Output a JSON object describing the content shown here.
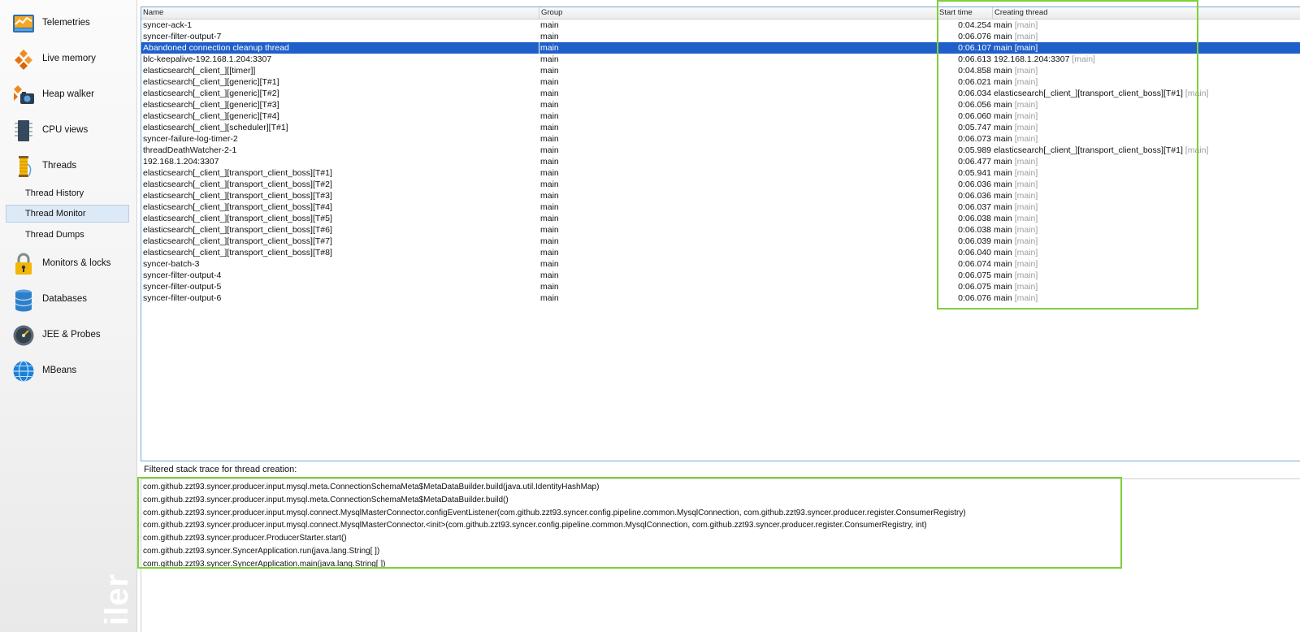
{
  "sidebar": {
    "items": [
      {
        "label": "Telemetries",
        "icon": "telemetries-icon"
      },
      {
        "label": "Live memory",
        "icon": "live-memory-icon"
      },
      {
        "label": "Heap walker",
        "icon": "heap-walker-icon"
      },
      {
        "label": "CPU views",
        "icon": "cpu-views-icon"
      },
      {
        "label": "Threads",
        "icon": "threads-icon"
      },
      {
        "label": "Monitors & locks",
        "icon": "lock-icon"
      },
      {
        "label": "Databases",
        "icon": "database-icon"
      },
      {
        "label": "JEE & Probes",
        "icon": "gauge-icon"
      },
      {
        "label": "MBeans",
        "icon": "globe-icon"
      }
    ],
    "thread_subitems": [
      {
        "label": "Thread History"
      },
      {
        "label": "Thread Monitor",
        "selected": true
      },
      {
        "label": "Thread Dumps"
      }
    ],
    "watermark": "iler"
  },
  "table": {
    "headers": {
      "name": "Name",
      "group": "Group",
      "start": "Start time",
      "creator": "Creating thread"
    },
    "rows": [
      {
        "name": "syncer-ack-1",
        "group": "main",
        "start": "0:04.254",
        "creator": "main",
        "creator_group": "[main]"
      },
      {
        "name": "syncer-filter-output-7",
        "group": "main",
        "start": "0:06.076",
        "creator": "main",
        "creator_group": "[main]"
      },
      {
        "name": "Abandoned connection cleanup thread",
        "group": "main",
        "start": "0:06.107",
        "creator": "main",
        "creator_group": "[main]",
        "selected": true
      },
      {
        "name": "blc-keepalive-192.168.1.204:3307",
        "group": "main",
        "start": "0:06.613",
        "creator": "192.168.1.204:3307",
        "creator_group": "[main]"
      },
      {
        "name": "elasticsearch[_client_][[timer]]",
        "group": "main",
        "start": "0:04.858",
        "creator": "main",
        "creator_group": "[main]"
      },
      {
        "name": "elasticsearch[_client_][generic][T#1]",
        "group": "main",
        "start": "0:06.021",
        "creator": "main",
        "creator_group": "[main]"
      },
      {
        "name": "elasticsearch[_client_][generic][T#2]",
        "group": "main",
        "start": "0:06.034",
        "creator": "elasticsearch[_client_][transport_client_boss][T#1]",
        "creator_group": "[main]"
      },
      {
        "name": "elasticsearch[_client_][generic][T#3]",
        "group": "main",
        "start": "0:06.056",
        "creator": "main",
        "creator_group": "[main]"
      },
      {
        "name": "elasticsearch[_client_][generic][T#4]",
        "group": "main",
        "start": "0:06.060",
        "creator": "main",
        "creator_group": "[main]"
      },
      {
        "name": "elasticsearch[_client_][scheduler][T#1]",
        "group": "main",
        "start": "0:05.747",
        "creator": "main",
        "creator_group": "[main]"
      },
      {
        "name": "syncer-failure-log-timer-2",
        "group": "main",
        "start": "0:06.073",
        "creator": "main",
        "creator_group": "[main]"
      },
      {
        "name": "threadDeathWatcher-2-1",
        "group": "main",
        "start": "0:05.989",
        "creator": "elasticsearch[_client_][transport_client_boss][T#1]",
        "creator_group": "[main]"
      },
      {
        "name": "192.168.1.204:3307",
        "group": "main",
        "start": "0:06.477",
        "creator": "main",
        "creator_group": "[main]"
      },
      {
        "name": "elasticsearch[_client_][transport_client_boss][T#1]",
        "group": "main",
        "start": "0:05.941",
        "creator": "main",
        "creator_group": "[main]"
      },
      {
        "name": "elasticsearch[_client_][transport_client_boss][T#2]",
        "group": "main",
        "start": "0:06.036",
        "creator": "main",
        "creator_group": "[main]"
      },
      {
        "name": "elasticsearch[_client_][transport_client_boss][T#3]",
        "group": "main",
        "start": "0:06.036",
        "creator": "main",
        "creator_group": "[main]"
      },
      {
        "name": "elasticsearch[_client_][transport_client_boss][T#4]",
        "group": "main",
        "start": "0:06.037",
        "creator": "main",
        "creator_group": "[main]"
      },
      {
        "name": "elasticsearch[_client_][transport_client_boss][T#5]",
        "group": "main",
        "start": "0:06.038",
        "creator": "main",
        "creator_group": "[main]"
      },
      {
        "name": "elasticsearch[_client_][transport_client_boss][T#6]",
        "group": "main",
        "start": "0:06.038",
        "creator": "main",
        "creator_group": "[main]"
      },
      {
        "name": "elasticsearch[_client_][transport_client_boss][T#7]",
        "group": "main",
        "start": "0:06.039",
        "creator": "main",
        "creator_group": "[main]"
      },
      {
        "name": "elasticsearch[_client_][transport_client_boss][T#8]",
        "group": "main",
        "start": "0:06.040",
        "creator": "main",
        "creator_group": "[main]"
      },
      {
        "name": "syncer-batch-3",
        "group": "main",
        "start": "0:06.074",
        "creator": "main",
        "creator_group": "[main]"
      },
      {
        "name": "syncer-filter-output-4",
        "group": "main",
        "start": "0:06.075",
        "creator": "main",
        "creator_group": "[main]"
      },
      {
        "name": "syncer-filter-output-5",
        "group": "main",
        "start": "0:06.075",
        "creator": "main",
        "creator_group": "[main]"
      },
      {
        "name": "syncer-filter-output-6",
        "group": "main",
        "start": "0:06.076",
        "creator": "main",
        "creator_group": "[main]"
      }
    ]
  },
  "trace": {
    "title": "Filtered stack trace for thread creation:",
    "lines": [
      "com.github.zzt93.syncer.producer.input.mysql.meta.ConnectionSchemaMeta$MetaDataBuilder.build(java.util.IdentityHashMap)",
      "com.github.zzt93.syncer.producer.input.mysql.meta.ConnectionSchemaMeta$MetaDataBuilder.build()",
      "com.github.zzt93.syncer.producer.input.mysql.connect.MysqlMasterConnector.configEventListener(com.github.zzt93.syncer.config.pipeline.common.MysqlConnection, com.github.zzt93.syncer.producer.register.ConsumerRegistry)",
      "com.github.zzt93.syncer.producer.input.mysql.connect.MysqlMasterConnector.<init>(com.github.zzt93.syncer.config.pipeline.common.MysqlConnection, com.github.zzt93.syncer.producer.register.ConsumerRegistry, int)",
      "com.github.zzt93.syncer.producer.ProducerStarter.start()",
      "com.github.zzt93.syncer.SyncerApplication.run(java.lang.String[ ])",
      "com.github.zzt93.syncer.SyncerApplication.main(java.lang.String[ ])"
    ]
  },
  "colors": {
    "selection": "#1f5fc9",
    "highlight_box": "#7fcf3a",
    "sub_selection": "#dce9f6"
  }
}
